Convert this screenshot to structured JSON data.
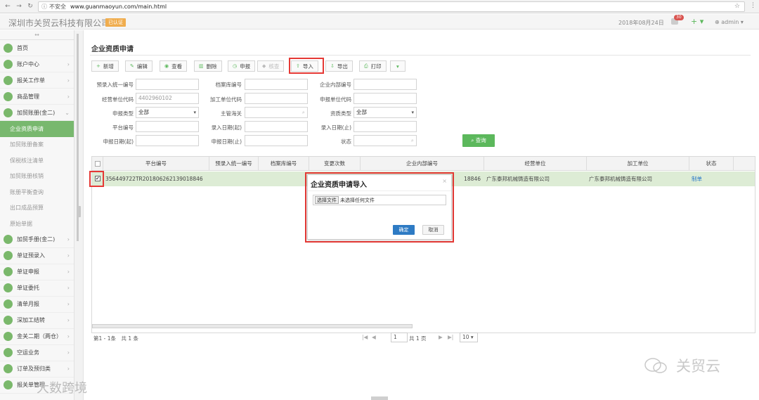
{
  "browser": {
    "security_label": "不安全",
    "url": "www.guanmaoyun.com/main.html"
  },
  "header": {
    "company": "深圳市关贸云科技有限公司",
    "cert_badge": "已认证",
    "date": "2018年08月24日",
    "msg_count": "30",
    "add_label": "+ ▾",
    "user": "admin"
  },
  "sidebar": {
    "collapse_glyph": "↔",
    "items": [
      {
        "label": "首页",
        "icon": "home-icon",
        "has_children": false
      },
      {
        "label": "账户中心",
        "icon": "account-icon",
        "has_children": true
      },
      {
        "label": "报关工作单",
        "icon": "worksheet-icon",
        "has_children": true
      },
      {
        "label": "商品管理",
        "icon": "goods-icon",
        "has_children": true
      },
      {
        "label": "加贸账册(金二)",
        "icon": "ledger-icon",
        "has_children": true,
        "expanded": true
      }
    ],
    "subitems": [
      {
        "label": "企业资质申请",
        "active": true
      },
      {
        "label": "加贸账册备案",
        "active": false
      },
      {
        "label": "保税核注清单",
        "active": false
      },
      {
        "label": "加贸账册核销",
        "active": false
      },
      {
        "label": "账册平衡查询",
        "active": false
      },
      {
        "label": "出口成品预算",
        "active": false
      },
      {
        "label": "原始单据",
        "active": false
      }
    ],
    "items2": [
      {
        "label": "加贸手册(金二)",
        "icon": "manual-icon"
      },
      {
        "label": "单证预录入",
        "icon": "prerecord-icon"
      },
      {
        "label": "单证申报",
        "icon": "declare-icon"
      },
      {
        "label": "单证委托",
        "icon": "entrust-icon"
      },
      {
        "label": "清单月报",
        "icon": "report-icon"
      },
      {
        "label": "深加工结转",
        "icon": "transfer-icon"
      },
      {
        "label": "金关二期（两仓）",
        "icon": "warehouse-icon"
      },
      {
        "label": "空运业务",
        "icon": "air-icon"
      },
      {
        "label": "订单及预归类",
        "icon": "order-icon"
      },
      {
        "label": "报关单管理",
        "icon": "doc-icon"
      }
    ]
  },
  "page": {
    "title": "企业资质申请"
  },
  "toolbar": {
    "add": "新增",
    "edit": "编辑",
    "view": "查看",
    "delete": "删除",
    "declare": "申报",
    "verify": "核查",
    "import": "导入",
    "export": "导出",
    "print": "打印",
    "more": "▾"
  },
  "form": {
    "f1_label": "预录入统一编号",
    "f2_label": "档案库编号",
    "f3_label": "企业内部编号",
    "f4_label": "经营单位代码",
    "f4_value": "4402960102",
    "f5_label": "加工单位代码",
    "f6_label": "申报单位代码",
    "f7_label": "申报类型",
    "f7_value": "全部",
    "f8_label": "主管海关",
    "f9_label": "资质类型",
    "f9_value": "全部",
    "f10_label": "平台编号",
    "f11_label": "录入日期(起)",
    "f12_label": "录入日期(止)",
    "f13_label": "申报日期(起)",
    "f14_label": "申报日期(止)",
    "f15_label": "状态",
    "query": "查询"
  },
  "grid": {
    "headers": [
      "平台编号",
      "预录入统一编号",
      "档案库编号",
      "变更次数",
      "企业内部编号",
      "经营单位",
      "加工单位",
      "状态"
    ],
    "rows": [
      {
        "platform_no": "356449722TR201806262139018846",
        "pre_no": "",
        "archive_no": "",
        "change_count": "",
        "internal_no": "18846",
        "operator": "广东泰邦机械铸造有限公司",
        "processor": "广东泰邦机械铸造有限公司",
        "status": "制单"
      }
    ]
  },
  "pager": {
    "summary": "第1 - 1条　共 1 条",
    "page": "1",
    "total_pages": "共 1 页",
    "page_size": "10"
  },
  "dialog": {
    "title": "企业资质申请导入",
    "close": "×",
    "file_button": "选择文件",
    "file_status": "未选择任何文件",
    "ok": "确定",
    "cancel": "取消"
  },
  "watermark": {
    "brand": "关贸云",
    "brand2": "大数跨境"
  },
  "colors": {
    "accent_green": "#78b86e",
    "highlight_red": "#e53935",
    "ok_blue": "#2e7bc4"
  }
}
